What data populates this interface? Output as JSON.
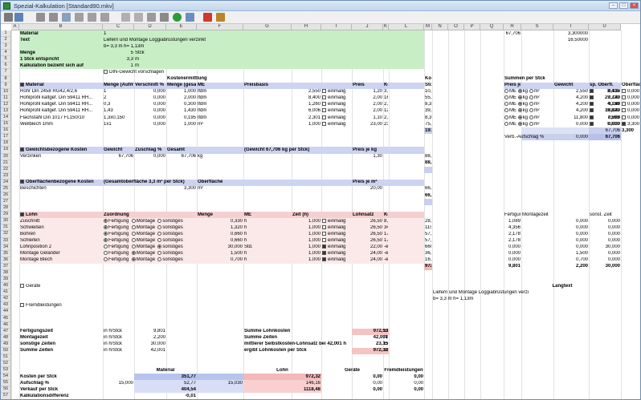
{
  "window": {
    "title": "Spezial-Kalkulation [Standard90.mkv]"
  },
  "cols": [
    "A",
    "B",
    "C",
    "D",
    "E",
    "F",
    "G",
    "H",
    "I",
    "J",
    "K",
    "L",
    "M",
    "N",
    "O",
    "P",
    "Q",
    "R",
    "S",
    "T",
    "U"
  ],
  "rows": [
    "1",
    "2",
    "3",
    "4",
    "5",
    "6",
    "7",
    "8",
    "9",
    "10",
    "11",
    "12",
    "13",
    "14",
    "15",
    "16",
    "17",
    "18",
    "19",
    "20",
    "21",
    "22",
    "23",
    "24",
    "25",
    "26",
    "27",
    "28",
    "29",
    "30",
    "31",
    "32",
    "33",
    "34",
    "35",
    "36",
    "37",
    "38",
    "39",
    "40",
    "41",
    "42",
    "43",
    "44",
    "45",
    "46",
    "47",
    "48",
    "49",
    "50",
    "51",
    "52",
    "53",
    "54",
    "55",
    "56",
    "57",
    "58"
  ],
  "header": {
    "material_label": "Material",
    "material_value": "1",
    "text_label": "Text",
    "text_value": "Liefern und  Montage Loggiabrüstungen verzinkt",
    "text_value2": "b= 3,3 m h= 1,13m",
    "menge_label": "Menge",
    "menge_value": "5",
    "menge_unit": "Stck",
    "stck_label": "1 Stck entspricht",
    "stck_value": "3,3",
    "stck_unit": "m",
    "bezieht_label": "Kalkulation bezieht sich auf",
    "bezieht_value": "1",
    "bezieht_unit": "m",
    "din_label": "DIN-Gewicht vorschlagen",
    "r_top1": "67,706",
    "r_top2": "3,300000",
    "r_top3": "16,50000"
  },
  "kosten": {
    "title": "Kostenermittlung",
    "kps_title": "Kosten per",
    "kps_title2": "Stck",
    "summen_title": "Summen per Stck",
    "cols": [
      "Material",
      "Menge (Aufmaß)",
      "Verschnitt %",
      "Menge (gesamt)",
      "ME",
      "Preisbasis",
      "Preis",
      "Kosten"
    ],
    "rcols": [
      "Preis je",
      "Gewicht",
      "sp. Oberfl.",
      "Oberfläche"
    ],
    "rows": [
      {
        "mat": "Rohr Din 2458 RG42,4/2,6",
        "menge": "1",
        "vs": "0,000",
        "mg": "1,000",
        "me": "lfdm",
        "pb": "2,550",
        "opt": "einmalig",
        "preis": "1,20",
        "kosten": "3,06",
        "kps": "10,10",
        "s_price": "2,550",
        "s_gew": "8,415",
        "s_sp": "0,130",
        "s_ob": "0,000"
      },
      {
        "mat": "Hohlprofil kaltgef. Din 59411 RH...",
        "menge": "2",
        "vs": "0,000",
        "mg": "2,000",
        "me": "lfdm",
        "pb": "8,400",
        "opt": "einmalig",
        "preis": "2,00",
        "kosten": "16,80",
        "kps": "55,44",
        "s_price": "4,200",
        "s_gew": "27,720",
        "s_sp": "0,140",
        "s_ob": "0,000"
      },
      {
        "mat": "Hohlprofil kaltgef. Din 59411 RH...",
        "menge": "0,3",
        "vs": "0,000",
        "mg": "0,300",
        "me": "lfdm",
        "pb": "1,260",
        "opt": "einmalig",
        "preis": "2,00",
        "kosten": "2,52",
        "kps": "8,32",
        "s_price": "4,200",
        "s_gew": "4,158",
        "s_sp": "0,140",
        "s_ob": "0,000"
      },
      {
        "mat": "Hohlprofil kaltgef. Din 59411 RH...",
        "menge": "1,43",
        "vs": "0,000",
        "mg": "1,430",
        "me": "lfdm",
        "pb": "6,006",
        "opt": "einmalig",
        "preis": "2,00",
        "kosten": "12,01",
        "kps": "39,64",
        "s_price": "4,200",
        "s_gew": "19,820",
        "s_sp": "0,140",
        "s_ob": "0,000"
      },
      {
        "mat": "Flachstahl Din 1017 FL150/10",
        "menge": "1,3x0,150",
        "vs": "0,000",
        "mg": "0,195",
        "me": "lfdm",
        "pb": "2,301",
        "opt": "einmalig",
        "preis": "1,10",
        "kosten": "2,53",
        "kps": "8,35",
        "s_price": "11,800",
        "s_gew": "7,593",
        "s_sp": "0,000",
        "s_ob": "0,000"
      },
      {
        "mat": "Wellblech 1mm",
        "menge": "1x1",
        "vs": "0,000",
        "mg": "1,000",
        "me": "m²",
        "pb": "1,000",
        "opt": "einmalig",
        "preis": "23,00",
        "kosten": "23,00",
        "kps": "75,90",
        "s_price": "0,000",
        "s_gew": "0,000",
        "s_sp": "0,000",
        "s_ob": "3,300"
      }
    ],
    "pj": [
      "ME",
      "kg",
      "m²"
    ],
    "total_kps": "197,75",
    "total_gew": "67,706",
    "total_ob": "3,300",
    "verb_label": "Verb.-Aufschlag %",
    "verb_value": "0,000",
    "verb_total": "67,706"
  },
  "gewicht": {
    "title": "Gewichtsbezogene Kosten",
    "c1": "Gewicht",
    "c2": "Zuschlag %",
    "c3": "Gesamt",
    "note": "(Gewicht 67,706 kg per Stck)",
    "c4": "Preis je kg",
    "row_name": "Verzinken",
    "row_g": "67,706",
    "row_z": "0,000",
    "row_ges": "67,706",
    "row_unit": "kg",
    "row_p": "1,30",
    "row_kps": "88,02",
    "total": "88,02"
  },
  "ober": {
    "title": "Oberflächenbezogene Kosten",
    "note": "(Gesamtoberfläche  3,3 m² per Stck)",
    "c1": "Oberfläche",
    "c2": "Preis je m²",
    "row_name": "Beschichten",
    "row_o": "3,300",
    "row_unit": "m²",
    "row_p": "20,00",
    "row_kps": "66,00",
    "total": "66,00"
  },
  "lohn": {
    "title": "Lohn",
    "c1": "Zuordnung",
    "c2": "Menge",
    "c3": "ME",
    "c4": "Zeit (h)",
    "c5": "Lohnsatz",
    "c6": "Kosten",
    "opts": [
      "Fertigung",
      "Montage",
      "sonstiges"
    ],
    "rcols": [
      "Fertigungs...",
      "Montagezeit",
      "sonst. Zeit"
    ],
    "rows": [
      {
        "name": "Zuschnitt",
        "z": 0,
        "menge": "0,330",
        "me": "h",
        "zeit": "1,000",
        "opt": "einmalig",
        "ls": "26,50",
        "kosten": "8,75",
        "kps": "28,86",
        "f": "1,089",
        "m": "0,000",
        "s": "0,000"
      },
      {
        "name": "Schweißen",
        "z": 0,
        "menge": "1,320",
        "me": "h",
        "zeit": "1,000",
        "opt": "einmalig",
        "ls": "26,50",
        "kosten": "34,98",
        "kps": "115,43",
        "f": "4,356",
        "m": "0,000",
        "s": "0,000"
      },
      {
        "name": "Bohren",
        "z": 0,
        "menge": "0,660",
        "me": "h",
        "zeit": "1,000",
        "opt": "einmalig",
        "ls": "26,50",
        "kosten": "17,49",
        "kps": "57,72",
        "f": "2,178",
        "m": "0,000",
        "s": "0,000"
      },
      {
        "name": "Schleifen",
        "z": 0,
        "menge": "0,660",
        "me": "h",
        "zeit": "1,000",
        "opt": "einmalig",
        "ls": "26,50",
        "kosten": "17,49",
        "kps": "57,72",
        "f": "2,178",
        "m": "0,000",
        "s": "0,000"
      },
      {
        "name": "Lohnposition 2",
        "z": 2,
        "menge": "30,000",
        "me": "Std.",
        "zeit": "1,000",
        "opt": "einmalig",
        "ls": "22,00",
        "kosten": "-einmalig-",
        "kps": "660,00",
        "f": "0,000",
        "m": "0,000",
        "s": "30,000"
      },
      {
        "name": "Montage Geländer",
        "z": 1,
        "menge": "1,500",
        "me": "h",
        "zeit": "1,000",
        "opt": "einmalig",
        "ls": "24,00",
        "kosten": "-einmalig-",
        "kps": "36,00",
        "f": "0,000",
        "m": "1,500",
        "s": "0,000"
      },
      {
        "name": "Montage Blech",
        "z": 1,
        "menge": "0,700",
        "me": "h",
        "zeit": "1,000",
        "opt": "einmalig",
        "ls": "24,00",
        "kosten": "-einmalig-",
        "kps": "16,80",
        "f": "0,000",
        "m": "0,700",
        "s": "0,000"
      }
    ],
    "total": "972,53",
    "tf": "9,801",
    "tm": "2,200",
    "ts": "30,000"
  },
  "geraete": "Geräte",
  "fremd": "Fremdleistungen",
  "langtext": {
    "title": "Langtext",
    "l1": "Liefern und  Montage Loggiabrüstungen verzinkt",
    "l2": "b= 3,3 m h= 1,13m"
  },
  "zeiten": [
    {
      "label": "Fertigungszeit",
      "unit": "in h/Stck",
      "val": "9,801",
      "rlabel": "Summe Lohnkosten",
      "rval": "972,53",
      "runit": "Euro/Stck"
    },
    {
      "label": "Montagezeit",
      "unit": "in h/Stck",
      "val": "2,200",
      "rlabel": "Summe Zeiten",
      "rval": "42,001",
      "runit": "h/Stck"
    },
    {
      "label": "sonstige Zeiten",
      "unit": "in h/Stck",
      "val": "30,000",
      "rlabel": "mittlerer Selbstkosten-Lohnsatz bei 42,001 h",
      "rval": "23,15",
      "runit": "Euro/h"
    },
    {
      "label": "Summe Zeiten",
      "unit": "in h/Stck",
      "val": "42,001",
      "rlabel": "ergibt Lohnkosten per Stck",
      "rval": "972,32",
      "runit": "Euro"
    }
  ],
  "summary": {
    "h_mat": "Material",
    "h_lohn": "Lohn",
    "h_ger": "Geräte",
    "h_fremd": "Fremdleistungen",
    "r1": "Kosten per Stck",
    "r2": "Aufschlag %",
    "r3": "Verkauf per Stck",
    "r4": "Kalkulationsdifferenz",
    "r5": "Verkauf Gesamt per Stck",
    "m1": "351,77",
    "m2a": "15,000",
    "m2": "52,77",
    "m3": "404,54",
    "l1": "972,32",
    "l2a": "15,030",
    "l2": "146,16",
    "l3": "1118,48",
    "g1": "0,00",
    "g2a": "15,000",
    "g2": "0,00",
    "g3": "0,00",
    "f1": "0,00",
    "f2a": "15,000",
    "f2": "0,00",
    "f3": "0,00",
    "diff": "-0,01",
    "gesamt": "1523,01"
  }
}
